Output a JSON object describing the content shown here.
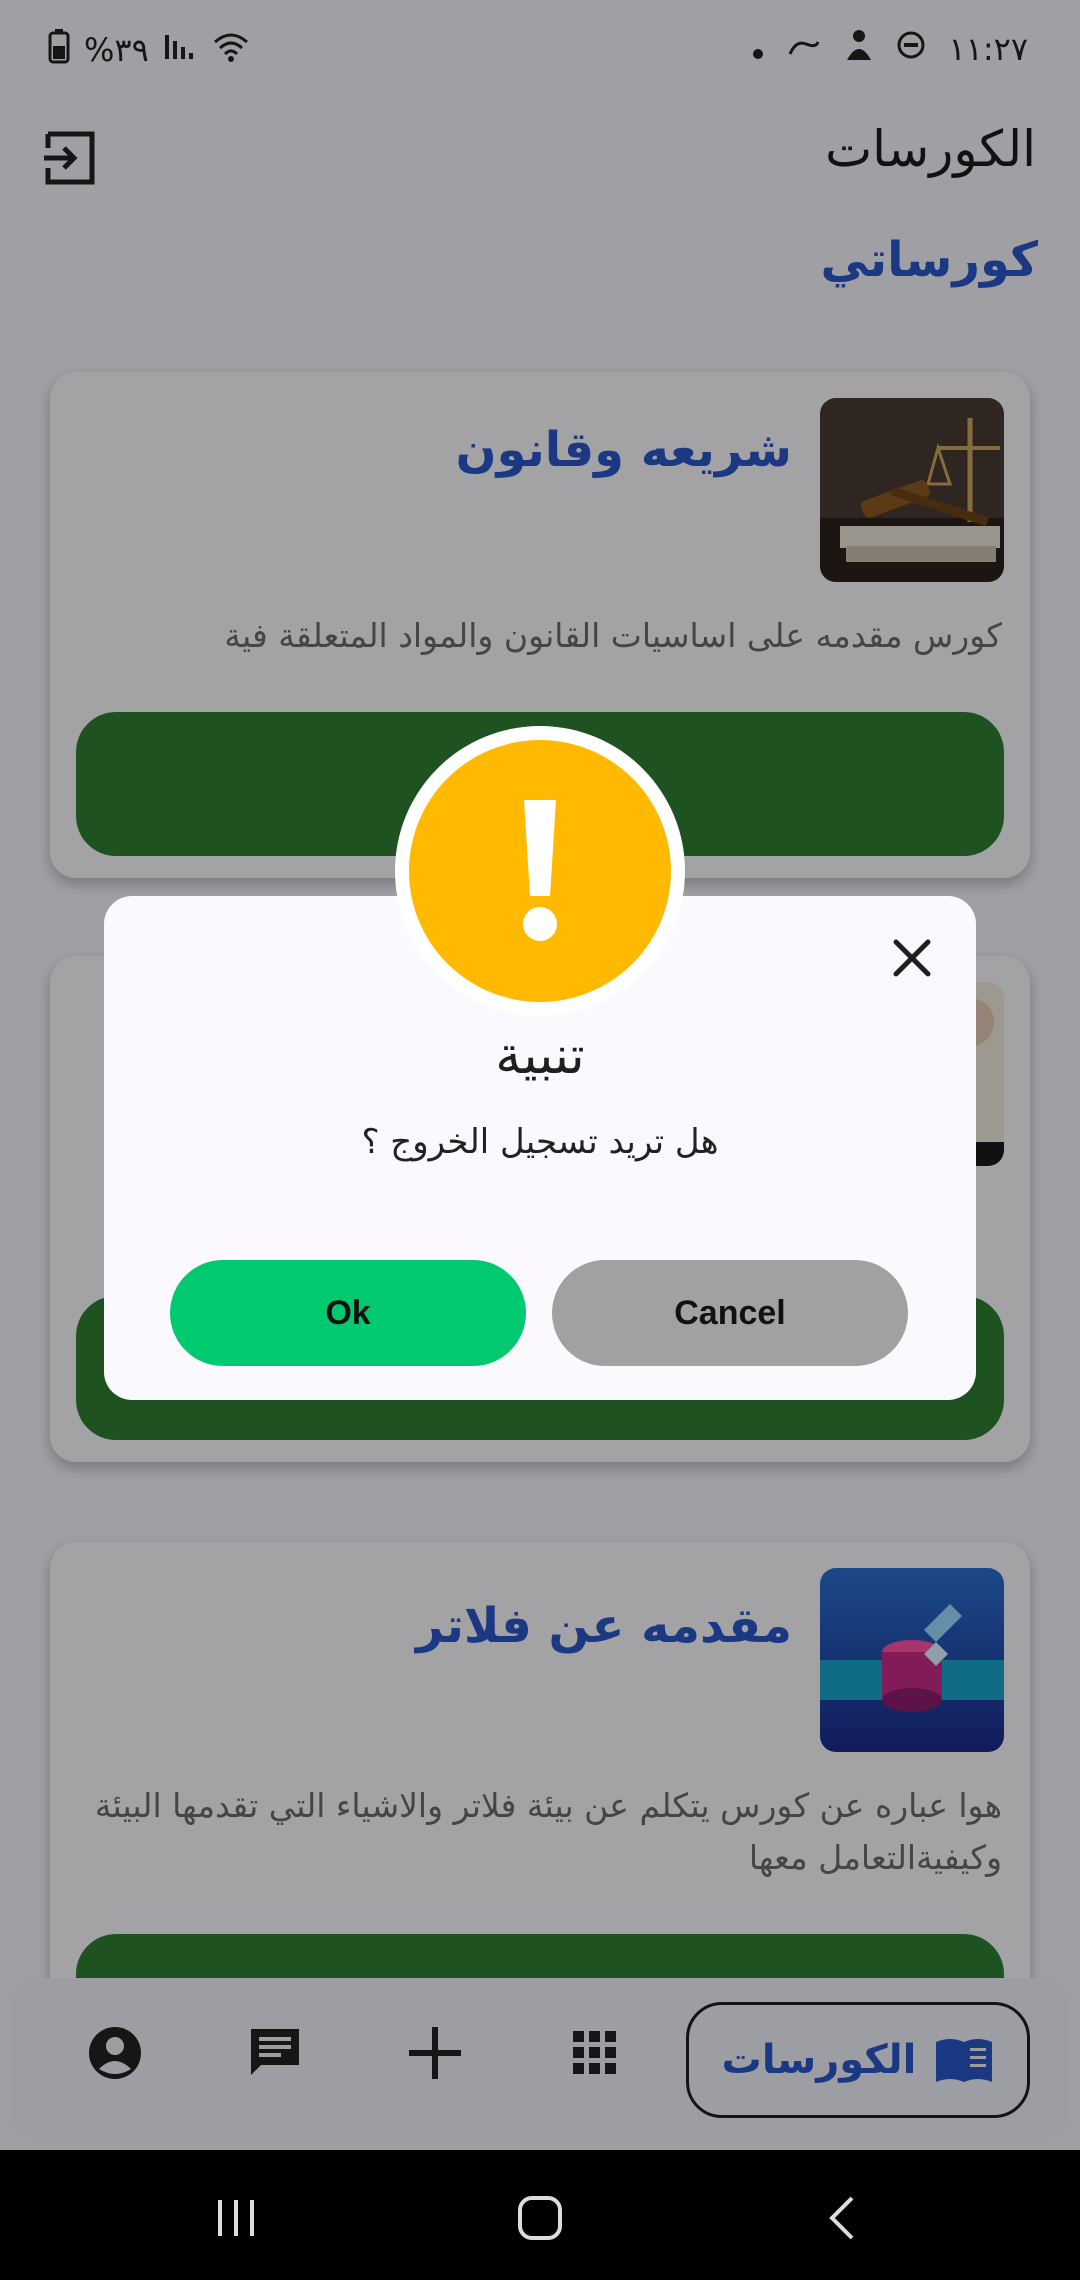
{
  "status_bar": {
    "time": "١١:٢٧",
    "battery": "%٣٩"
  },
  "header": {
    "title": "الكورسات"
  },
  "section": {
    "title": "كورساتي"
  },
  "courses": [
    {
      "title": "شريعه وقانون",
      "description": "كورس مقدمه على اساسيات القانون والمواد المتعلقة فية"
    },
    {
      "title": "",
      "description": ""
    },
    {
      "title": "مقدمه عن فلاتر",
      "description": "هوا عباره عن كورس يتكلم عن بيئة فلاتر والاشياء التي تقدمها البيئة وكيفيةالتعامل معها"
    }
  ],
  "bottom_nav": {
    "active_label": "الكورسات"
  },
  "dialog": {
    "title": "تنبية",
    "message": "هل تريد تسجيل الخروج ؟",
    "ok_label": "Ok",
    "cancel_label": "Cancel"
  },
  "colors": {
    "accent": "#2a56c6",
    "course_button": "#2e7d32",
    "ok_button": "#00c96f",
    "cancel_button": "#a1a1a1",
    "warning": "#ffb900"
  }
}
